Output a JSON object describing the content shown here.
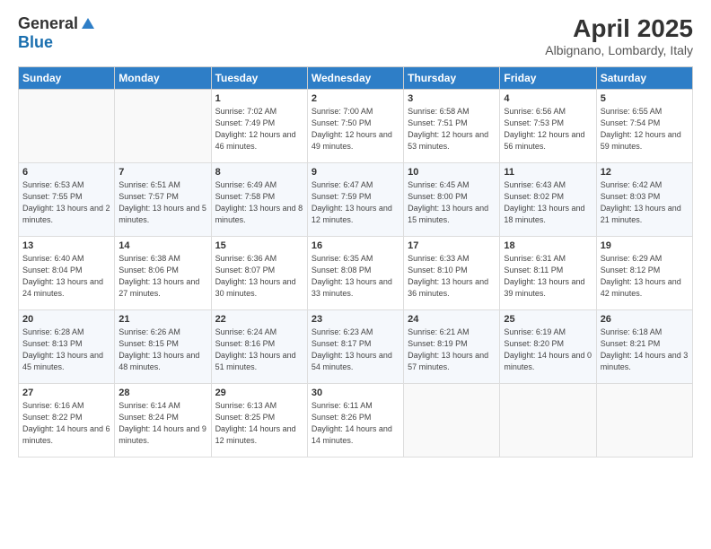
{
  "logo": {
    "general": "General",
    "blue": "Blue"
  },
  "title": "April 2025",
  "location": "Albignano, Lombardy, Italy",
  "weekdays": [
    "Sunday",
    "Monday",
    "Tuesday",
    "Wednesday",
    "Thursday",
    "Friday",
    "Saturday"
  ],
  "weeks": [
    [
      {
        "day": "",
        "info": ""
      },
      {
        "day": "",
        "info": ""
      },
      {
        "day": "1",
        "info": "Sunrise: 7:02 AM\nSunset: 7:49 PM\nDaylight: 12 hours and 46 minutes."
      },
      {
        "day": "2",
        "info": "Sunrise: 7:00 AM\nSunset: 7:50 PM\nDaylight: 12 hours and 49 minutes."
      },
      {
        "day": "3",
        "info": "Sunrise: 6:58 AM\nSunset: 7:51 PM\nDaylight: 12 hours and 53 minutes."
      },
      {
        "day": "4",
        "info": "Sunrise: 6:56 AM\nSunset: 7:53 PM\nDaylight: 12 hours and 56 minutes."
      },
      {
        "day": "5",
        "info": "Sunrise: 6:55 AM\nSunset: 7:54 PM\nDaylight: 12 hours and 59 minutes."
      }
    ],
    [
      {
        "day": "6",
        "info": "Sunrise: 6:53 AM\nSunset: 7:55 PM\nDaylight: 13 hours and 2 minutes."
      },
      {
        "day": "7",
        "info": "Sunrise: 6:51 AM\nSunset: 7:57 PM\nDaylight: 13 hours and 5 minutes."
      },
      {
        "day": "8",
        "info": "Sunrise: 6:49 AM\nSunset: 7:58 PM\nDaylight: 13 hours and 8 minutes."
      },
      {
        "day": "9",
        "info": "Sunrise: 6:47 AM\nSunset: 7:59 PM\nDaylight: 13 hours and 12 minutes."
      },
      {
        "day": "10",
        "info": "Sunrise: 6:45 AM\nSunset: 8:00 PM\nDaylight: 13 hours and 15 minutes."
      },
      {
        "day": "11",
        "info": "Sunrise: 6:43 AM\nSunset: 8:02 PM\nDaylight: 13 hours and 18 minutes."
      },
      {
        "day": "12",
        "info": "Sunrise: 6:42 AM\nSunset: 8:03 PM\nDaylight: 13 hours and 21 minutes."
      }
    ],
    [
      {
        "day": "13",
        "info": "Sunrise: 6:40 AM\nSunset: 8:04 PM\nDaylight: 13 hours and 24 minutes."
      },
      {
        "day": "14",
        "info": "Sunrise: 6:38 AM\nSunset: 8:06 PM\nDaylight: 13 hours and 27 minutes."
      },
      {
        "day": "15",
        "info": "Sunrise: 6:36 AM\nSunset: 8:07 PM\nDaylight: 13 hours and 30 minutes."
      },
      {
        "day": "16",
        "info": "Sunrise: 6:35 AM\nSunset: 8:08 PM\nDaylight: 13 hours and 33 minutes."
      },
      {
        "day": "17",
        "info": "Sunrise: 6:33 AM\nSunset: 8:10 PM\nDaylight: 13 hours and 36 minutes."
      },
      {
        "day": "18",
        "info": "Sunrise: 6:31 AM\nSunset: 8:11 PM\nDaylight: 13 hours and 39 minutes."
      },
      {
        "day": "19",
        "info": "Sunrise: 6:29 AM\nSunset: 8:12 PM\nDaylight: 13 hours and 42 minutes."
      }
    ],
    [
      {
        "day": "20",
        "info": "Sunrise: 6:28 AM\nSunset: 8:13 PM\nDaylight: 13 hours and 45 minutes."
      },
      {
        "day": "21",
        "info": "Sunrise: 6:26 AM\nSunset: 8:15 PM\nDaylight: 13 hours and 48 minutes."
      },
      {
        "day": "22",
        "info": "Sunrise: 6:24 AM\nSunset: 8:16 PM\nDaylight: 13 hours and 51 minutes."
      },
      {
        "day": "23",
        "info": "Sunrise: 6:23 AM\nSunset: 8:17 PM\nDaylight: 13 hours and 54 minutes."
      },
      {
        "day": "24",
        "info": "Sunrise: 6:21 AM\nSunset: 8:19 PM\nDaylight: 13 hours and 57 minutes."
      },
      {
        "day": "25",
        "info": "Sunrise: 6:19 AM\nSunset: 8:20 PM\nDaylight: 14 hours and 0 minutes."
      },
      {
        "day": "26",
        "info": "Sunrise: 6:18 AM\nSunset: 8:21 PM\nDaylight: 14 hours and 3 minutes."
      }
    ],
    [
      {
        "day": "27",
        "info": "Sunrise: 6:16 AM\nSunset: 8:22 PM\nDaylight: 14 hours and 6 minutes."
      },
      {
        "day": "28",
        "info": "Sunrise: 6:14 AM\nSunset: 8:24 PM\nDaylight: 14 hours and 9 minutes."
      },
      {
        "day": "29",
        "info": "Sunrise: 6:13 AM\nSunset: 8:25 PM\nDaylight: 14 hours and 12 minutes."
      },
      {
        "day": "30",
        "info": "Sunrise: 6:11 AM\nSunset: 8:26 PM\nDaylight: 14 hours and 14 minutes."
      },
      {
        "day": "",
        "info": ""
      },
      {
        "day": "",
        "info": ""
      },
      {
        "day": "",
        "info": ""
      }
    ]
  ]
}
